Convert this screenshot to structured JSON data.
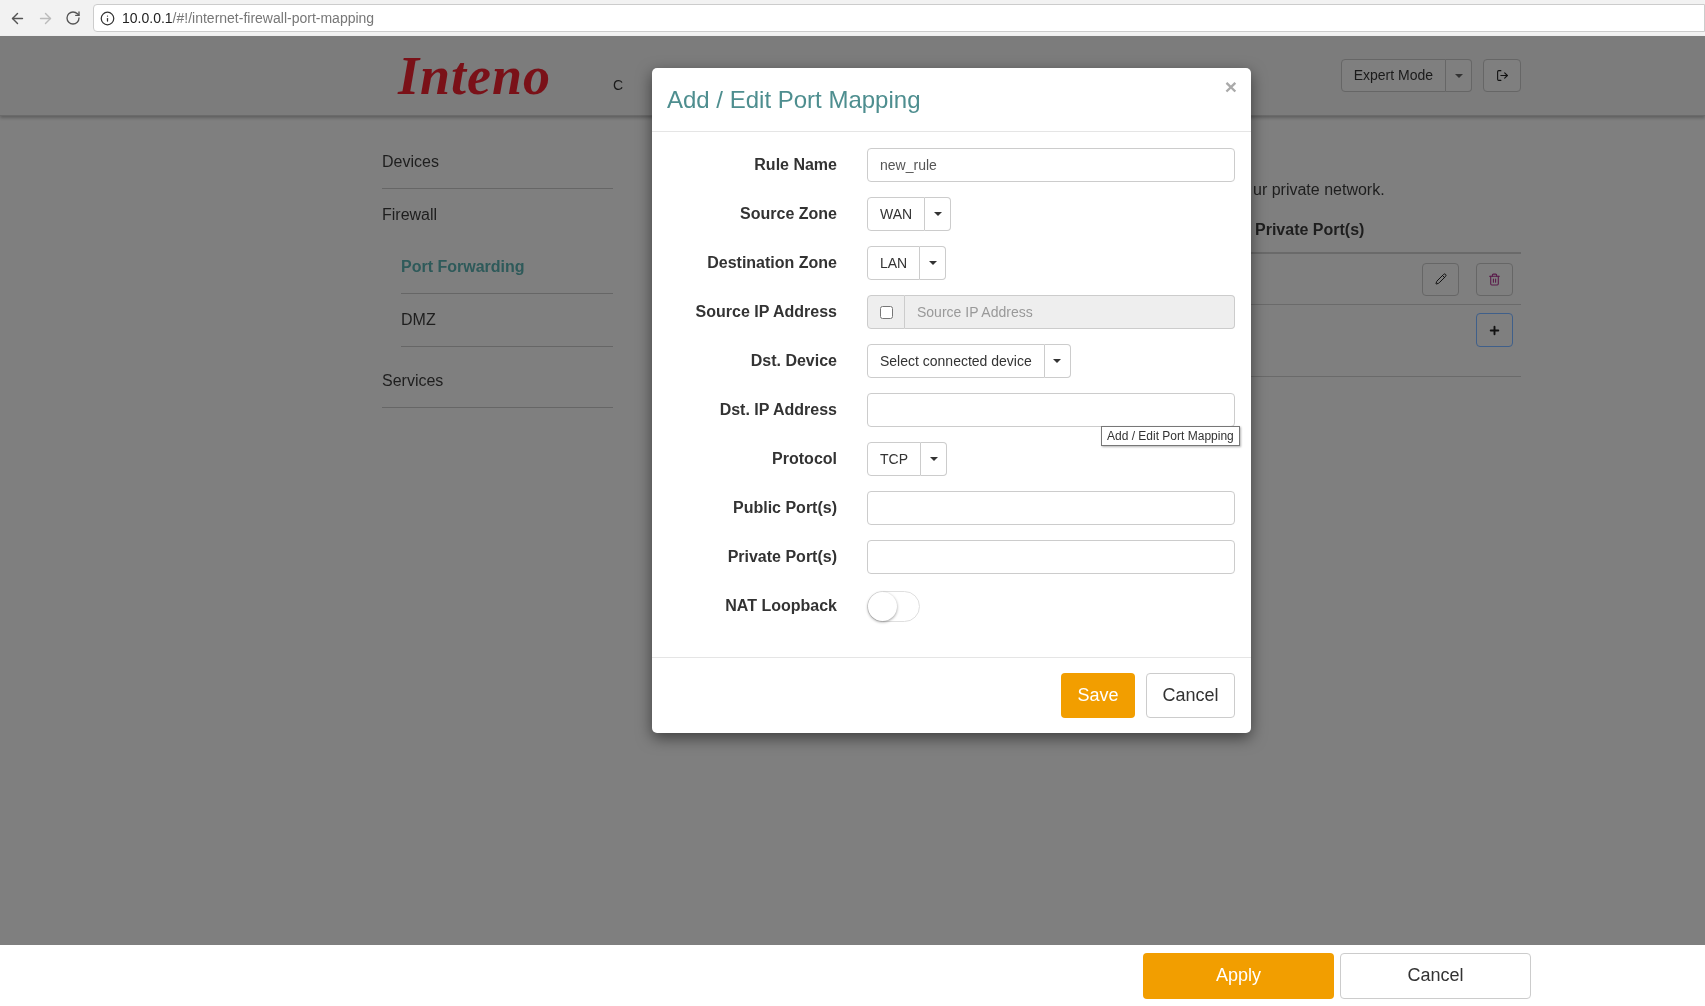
{
  "browser": {
    "url_host": "10.0.0.1",
    "url_path": "/#!/internet-firewall-port-mapping"
  },
  "header": {
    "logo": "Inteno",
    "nav_item": "C",
    "mode_button": "Expert Mode"
  },
  "sidebar": {
    "items": [
      {
        "label": "Devices",
        "selected": false
      },
      {
        "label": "Firewall",
        "selected": false,
        "children": [
          {
            "label": "Port Forwarding",
            "selected": true
          },
          {
            "label": "DMZ",
            "selected": false
          }
        ]
      },
      {
        "label": "Services",
        "selected": false
      }
    ]
  },
  "content": {
    "description": "ur private network.",
    "column_header": "Private Port(s)"
  },
  "modal": {
    "title": "Add / Edit Port Mapping",
    "close": "×",
    "fields": [
      {
        "kind": "text",
        "label": "Rule Name",
        "value": "new_rule"
      },
      {
        "kind": "select",
        "label": "Source Zone",
        "value": "WAN"
      },
      {
        "kind": "select",
        "label": "Destination Zone",
        "value": "LAN"
      },
      {
        "kind": "checkinput",
        "label": "Source IP Address",
        "placeholder": "Source IP Address",
        "checked": false
      },
      {
        "kind": "select",
        "label": "Dst. Device",
        "value": "Select connected device"
      },
      {
        "kind": "text",
        "label": "Dst. IP Address"
      },
      {
        "kind": "select",
        "label": "Protocol",
        "value": "TCP"
      },
      {
        "kind": "text",
        "label": "Public Port(s)"
      },
      {
        "kind": "text",
        "label": "Private Port(s)"
      },
      {
        "kind": "toggle",
        "label": "NAT Loopback",
        "on": false
      }
    ],
    "save": "Save",
    "cancel": "Cancel"
  },
  "tooltip": "Add / Edit Port Mapping",
  "footer": {
    "apply": "Apply",
    "cancel": "Cancel"
  }
}
